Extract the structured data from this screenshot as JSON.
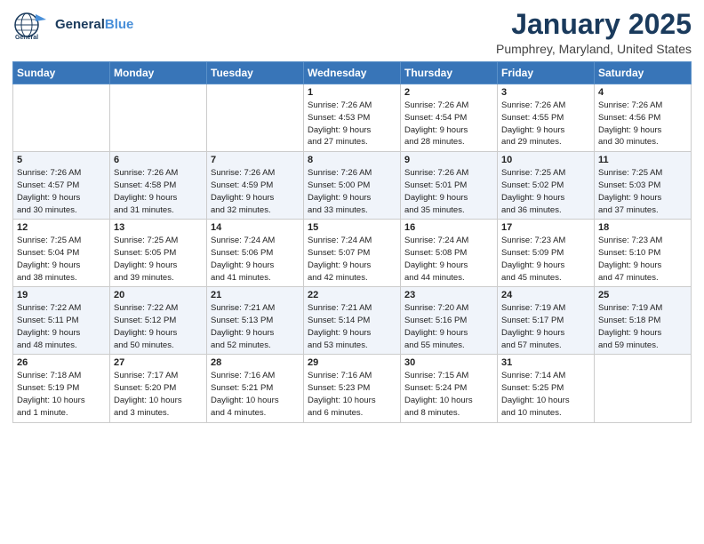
{
  "header": {
    "logo": {
      "line1": "General",
      "line2": "Blue"
    },
    "month": "January 2025",
    "location": "Pumphrey, Maryland, United States"
  },
  "weekdays": [
    "Sunday",
    "Monday",
    "Tuesday",
    "Wednesday",
    "Thursday",
    "Friday",
    "Saturday"
  ],
  "weeks": [
    [
      {
        "day": "",
        "info": ""
      },
      {
        "day": "",
        "info": ""
      },
      {
        "day": "",
        "info": ""
      },
      {
        "day": "1",
        "info": "Sunrise: 7:26 AM\nSunset: 4:53 PM\nDaylight: 9 hours\nand 27 minutes."
      },
      {
        "day": "2",
        "info": "Sunrise: 7:26 AM\nSunset: 4:54 PM\nDaylight: 9 hours\nand 28 minutes."
      },
      {
        "day": "3",
        "info": "Sunrise: 7:26 AM\nSunset: 4:55 PM\nDaylight: 9 hours\nand 29 minutes."
      },
      {
        "day": "4",
        "info": "Sunrise: 7:26 AM\nSunset: 4:56 PM\nDaylight: 9 hours\nand 30 minutes."
      }
    ],
    [
      {
        "day": "5",
        "info": "Sunrise: 7:26 AM\nSunset: 4:57 PM\nDaylight: 9 hours\nand 30 minutes."
      },
      {
        "day": "6",
        "info": "Sunrise: 7:26 AM\nSunset: 4:58 PM\nDaylight: 9 hours\nand 31 minutes."
      },
      {
        "day": "7",
        "info": "Sunrise: 7:26 AM\nSunset: 4:59 PM\nDaylight: 9 hours\nand 32 minutes."
      },
      {
        "day": "8",
        "info": "Sunrise: 7:26 AM\nSunset: 5:00 PM\nDaylight: 9 hours\nand 33 minutes."
      },
      {
        "day": "9",
        "info": "Sunrise: 7:26 AM\nSunset: 5:01 PM\nDaylight: 9 hours\nand 35 minutes."
      },
      {
        "day": "10",
        "info": "Sunrise: 7:25 AM\nSunset: 5:02 PM\nDaylight: 9 hours\nand 36 minutes."
      },
      {
        "day": "11",
        "info": "Sunrise: 7:25 AM\nSunset: 5:03 PM\nDaylight: 9 hours\nand 37 minutes."
      }
    ],
    [
      {
        "day": "12",
        "info": "Sunrise: 7:25 AM\nSunset: 5:04 PM\nDaylight: 9 hours\nand 38 minutes."
      },
      {
        "day": "13",
        "info": "Sunrise: 7:25 AM\nSunset: 5:05 PM\nDaylight: 9 hours\nand 39 minutes."
      },
      {
        "day": "14",
        "info": "Sunrise: 7:24 AM\nSunset: 5:06 PM\nDaylight: 9 hours\nand 41 minutes."
      },
      {
        "day": "15",
        "info": "Sunrise: 7:24 AM\nSunset: 5:07 PM\nDaylight: 9 hours\nand 42 minutes."
      },
      {
        "day": "16",
        "info": "Sunrise: 7:24 AM\nSunset: 5:08 PM\nDaylight: 9 hours\nand 44 minutes."
      },
      {
        "day": "17",
        "info": "Sunrise: 7:23 AM\nSunset: 5:09 PM\nDaylight: 9 hours\nand 45 minutes."
      },
      {
        "day": "18",
        "info": "Sunrise: 7:23 AM\nSunset: 5:10 PM\nDaylight: 9 hours\nand 47 minutes."
      }
    ],
    [
      {
        "day": "19",
        "info": "Sunrise: 7:22 AM\nSunset: 5:11 PM\nDaylight: 9 hours\nand 48 minutes."
      },
      {
        "day": "20",
        "info": "Sunrise: 7:22 AM\nSunset: 5:12 PM\nDaylight: 9 hours\nand 50 minutes."
      },
      {
        "day": "21",
        "info": "Sunrise: 7:21 AM\nSunset: 5:13 PM\nDaylight: 9 hours\nand 52 minutes."
      },
      {
        "day": "22",
        "info": "Sunrise: 7:21 AM\nSunset: 5:14 PM\nDaylight: 9 hours\nand 53 minutes."
      },
      {
        "day": "23",
        "info": "Sunrise: 7:20 AM\nSunset: 5:16 PM\nDaylight: 9 hours\nand 55 minutes."
      },
      {
        "day": "24",
        "info": "Sunrise: 7:19 AM\nSunset: 5:17 PM\nDaylight: 9 hours\nand 57 minutes."
      },
      {
        "day": "25",
        "info": "Sunrise: 7:19 AM\nSunset: 5:18 PM\nDaylight: 9 hours\nand 59 minutes."
      }
    ],
    [
      {
        "day": "26",
        "info": "Sunrise: 7:18 AM\nSunset: 5:19 PM\nDaylight: 10 hours\nand 1 minute."
      },
      {
        "day": "27",
        "info": "Sunrise: 7:17 AM\nSunset: 5:20 PM\nDaylight: 10 hours\nand 3 minutes."
      },
      {
        "day": "28",
        "info": "Sunrise: 7:16 AM\nSunset: 5:21 PM\nDaylight: 10 hours\nand 4 minutes."
      },
      {
        "day": "29",
        "info": "Sunrise: 7:16 AM\nSunset: 5:23 PM\nDaylight: 10 hours\nand 6 minutes."
      },
      {
        "day": "30",
        "info": "Sunrise: 7:15 AM\nSunset: 5:24 PM\nDaylight: 10 hours\nand 8 minutes."
      },
      {
        "day": "31",
        "info": "Sunrise: 7:14 AM\nSunset: 5:25 PM\nDaylight: 10 hours\nand 10 minutes."
      },
      {
        "day": "",
        "info": ""
      }
    ]
  ]
}
